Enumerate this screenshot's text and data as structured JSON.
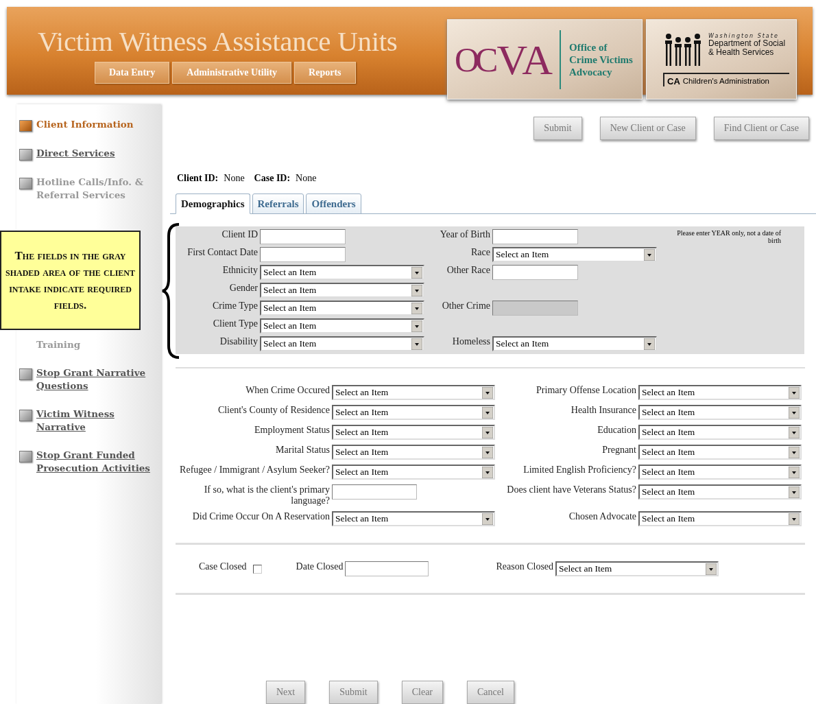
{
  "header": {
    "title": "Victim Witness Assistance Units",
    "nav": [
      {
        "label": "Data Entry"
      },
      {
        "label": "Administrative Utility"
      },
      {
        "label": "Reports"
      }
    ],
    "ocva_logo": {
      "mark_left": "OC",
      "mark_right": "VA",
      "lines": [
        "Office of",
        "Crime Victims",
        "Advocacy"
      ]
    },
    "dshs_logo": {
      "state": "Washington State",
      "lines": [
        "Department of Social",
        "& Health Services"
      ],
      "division_abbr": "CA",
      "division": "Children's Administration"
    }
  },
  "sidebar": {
    "items_above": [
      {
        "label": "Client Information",
        "selected": true,
        "disabled": false
      },
      {
        "label": "Direct Services",
        "selected": false,
        "disabled": false
      },
      {
        "label": "Hotline Calls/Info. & Referral Services",
        "selected": false,
        "disabled": true
      }
    ],
    "covered_item": {
      "label": "Training"
    },
    "items_below": [
      {
        "label": "Stop Grant Narrative Questions",
        "selected": false,
        "disabled": false
      },
      {
        "label": "Victim Witness Narrative",
        "selected": false,
        "disabled": false
      },
      {
        "label": "Stop Grant Funded Prosecution Activities",
        "selected": false,
        "disabled": false
      }
    ]
  },
  "actions": [
    "Submit",
    "New Client or Case",
    "Find Client or Case"
  ],
  "case_info": [
    {
      "label": "Client ID:",
      "value": "None"
    },
    {
      "label": "Case ID:",
      "value": "None"
    }
  ],
  "tabs": [
    {
      "label": "Demographics",
      "selected": true
    },
    {
      "label": "Referrals",
      "selected": false
    },
    {
      "label": "Offenders",
      "selected": false
    }
  ],
  "required_section": {
    "note": "Please enter YEAR only, not a date of birth",
    "rows": [
      {
        "left": {
          "label": "Client ID",
          "kind": "text",
          "disabled": false
        },
        "right": {
          "label": "Year of Birth",
          "kind": "text",
          "disabled": false
        }
      },
      {
        "left": {
          "label": "First Contact Date",
          "kind": "text",
          "disabled": false
        },
        "right": {
          "label": "Race",
          "kind": "select",
          "value": "Select an Item"
        }
      },
      {
        "left": {
          "label": "Ethnicity",
          "kind": "select",
          "value": "Select an Item"
        },
        "right": {
          "label": "Other Race",
          "kind": "text",
          "disabled": false
        }
      },
      {
        "left": {
          "label": "Gender",
          "kind": "select",
          "value": "Select an Item"
        }
      },
      {
        "left": {
          "label": "Crime Type",
          "kind": "select",
          "value": "Select an Item"
        },
        "right": {
          "label": "Other Crime",
          "kind": "text",
          "disabled": true
        }
      },
      {
        "left": {
          "label": "Client Type",
          "kind": "select",
          "value": "Select an Item"
        }
      },
      {
        "left": {
          "label": "Disability",
          "kind": "select",
          "value": "Select an Item"
        },
        "right": {
          "label": "Homeless",
          "kind": "select",
          "value": "Select an Item"
        }
      }
    ]
  },
  "details_section": {
    "rows": [
      {
        "left": {
          "label": "When Crime Occured",
          "kind": "select",
          "value": "Select an Item"
        },
        "right": {
          "label": "Primary Offense Location",
          "kind": "select",
          "value": "Select an Item"
        }
      },
      {
        "left": {
          "label": "Client's County of Residence",
          "kind": "select",
          "value": "Select an Item"
        },
        "right": {
          "label": "Health Insurance",
          "kind": "select",
          "value": "Select an Item"
        }
      },
      {
        "left": {
          "label": "Employment Status",
          "kind": "select",
          "value": "Select an Item"
        },
        "right": {
          "label": "Education",
          "kind": "select",
          "value": "Select an Item"
        }
      },
      {
        "left": {
          "label": "Marital Status",
          "kind": "select",
          "value": "Select an Item"
        },
        "right": {
          "label": "Pregnant",
          "kind": "select",
          "value": "Select an Item"
        }
      },
      {
        "left": {
          "label": "Refugee / Immigrant / Asylum Seeker?",
          "kind": "select",
          "value": "Select an Item"
        },
        "right": {
          "label": "Limited English Proficiency?",
          "kind": "select",
          "value": "Select an Item"
        }
      },
      {
        "left": {
          "label": "If so, what is the client's primary language?",
          "kind": "text",
          "disabled": false
        },
        "right": {
          "label": "Does client have Veterans Status?",
          "kind": "select",
          "value": "Select an Item"
        }
      },
      {
        "left": {
          "label": "Did Crime Occur On A Reservation",
          "kind": "select",
          "value": "Select an Item"
        },
        "right": {
          "label": "Chosen Advocate",
          "kind": "select",
          "value": "Select an Item"
        }
      }
    ]
  },
  "closing": {
    "case_closed": {
      "label": "Case Closed",
      "checked": false
    },
    "date_closed": {
      "label": "Date Closed"
    },
    "reason_closed": {
      "label": "Reason Closed",
      "value": "Select an Item"
    }
  },
  "bottom_buttons": [
    "Next",
    "Submit",
    "Clear",
    "Cancel"
  ],
  "callout": {
    "text": "The fields in the gray shaded area of the client intake indicate required fields."
  }
}
